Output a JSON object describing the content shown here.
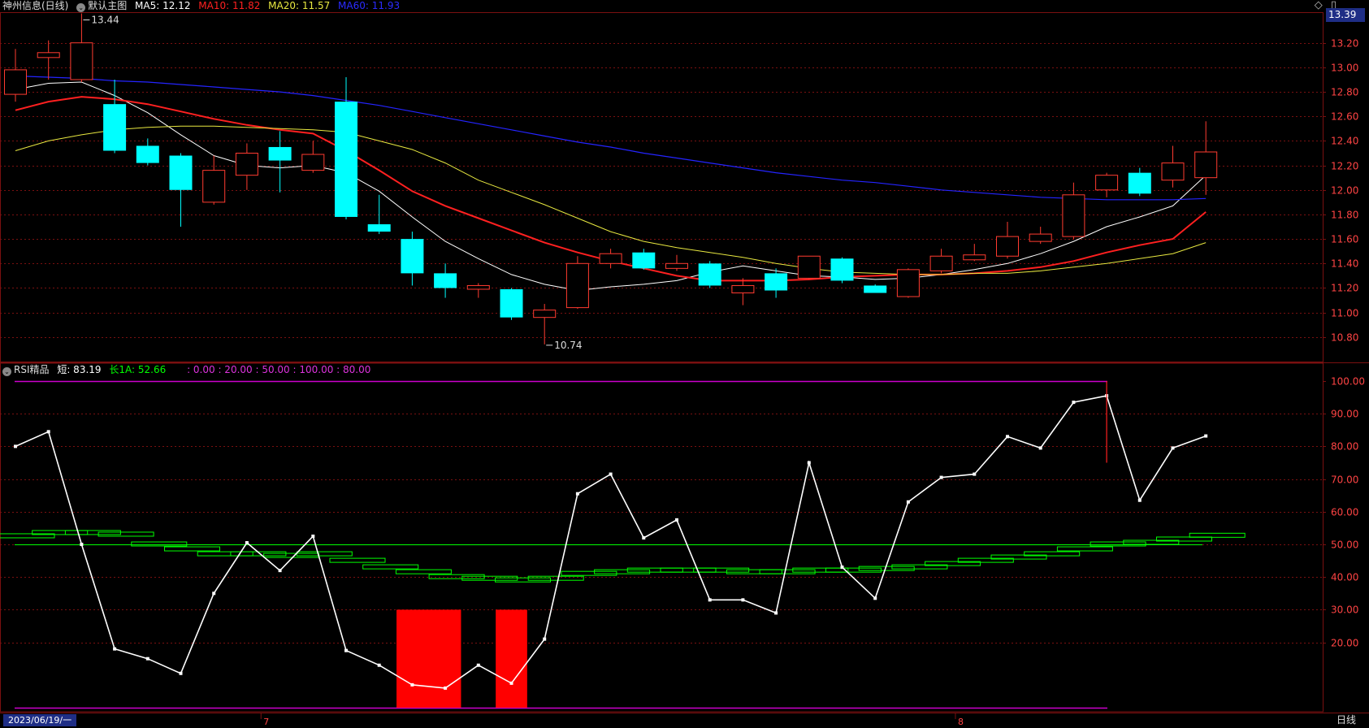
{
  "main_legend": {
    "title": "神州信息(日线)",
    "chart_name": "默认主图",
    "ma5_label": "MA5: 12.12",
    "ma10_label": "MA10: 11.82",
    "ma20_label": "MA20: 11.57",
    "ma60_label": "MA60: 11.93"
  },
  "rsi_legend": {
    "title": "RSI精品",
    "short_label": "短: 83.19",
    "long_label": "长1A: 52.66",
    "levels_label": ": 0.00 : 20.00 : 50.00 : 100.00 : 80.00"
  },
  "top_icons": {
    "diamond": "◇",
    "window": "▯"
  },
  "current_price": "13.39",
  "date_badge": "2023/06/19/一",
  "period_label": "日线",
  "colors": {
    "up": "#ff3b30",
    "down": "#00ffff",
    "ma5": "#ffffff",
    "ma10": "#ff2020",
    "ma20": "#e8e840",
    "ma60": "#2424ff",
    "rsi": "#ffffff",
    "long": "#00ff00",
    "band": "#cc00cc",
    "grid": "#7a1010",
    "axis_text": "#ff4444"
  },
  "chart_data": [
    {
      "type": "candlestick",
      "title": "神州信息(日线)",
      "ylim": [
        10.6,
        13.45
      ],
      "y_ticks": [
        "13.20",
        "13.00",
        "12.80",
        "12.60",
        "12.40",
        "12.20",
        "12.00",
        "11.80",
        "11.60",
        "11.40",
        "11.20",
        "11.00",
        "10.80"
      ],
      "x_labels": [
        {
          "index": 8,
          "label": "7"
        },
        {
          "index": 29,
          "label": "8"
        }
      ],
      "annotations": [
        {
          "index": 2,
          "value": 13.44,
          "label": "13.44",
          "position": "high"
        },
        {
          "index": 16,
          "value": 10.74,
          "label": "10.74",
          "position": "low"
        }
      ],
      "candles": [
        {
          "o": 12.78,
          "h": 13.15,
          "l": 12.72,
          "c": 12.98
        },
        {
          "o": 13.08,
          "h": 13.22,
          "l": 12.9,
          "c": 13.12
        },
        {
          "o": 12.9,
          "h": 13.44,
          "l": 12.88,
          "c": 13.2
        },
        {
          "o": 12.7,
          "h": 12.9,
          "l": 12.3,
          "c": 12.32
        },
        {
          "o": 12.36,
          "h": 12.42,
          "l": 12.2,
          "c": 12.22
        },
        {
          "o": 12.28,
          "h": 12.3,
          "l": 11.7,
          "c": 12.0
        },
        {
          "o": 11.9,
          "h": 12.28,
          "l": 11.88,
          "c": 12.16
        },
        {
          "o": 12.12,
          "h": 12.38,
          "l": 12.0,
          "c": 12.3
        },
        {
          "o": 12.35,
          "h": 12.48,
          "l": 11.98,
          "c": 12.24
        },
        {
          "o": 12.16,
          "h": 12.4,
          "l": 12.14,
          "c": 12.29
        },
        {
          "o": 12.72,
          "h": 12.92,
          "l": 11.76,
          "c": 11.78
        },
        {
          "o": 11.72,
          "h": 11.96,
          "l": 11.64,
          "c": 11.66
        },
        {
          "o": 11.6,
          "h": 11.66,
          "l": 11.22,
          "c": 11.32
        },
        {
          "o": 11.32,
          "h": 11.4,
          "l": 11.12,
          "c": 11.2
        },
        {
          "o": 11.19,
          "h": 11.24,
          "l": 11.12,
          "c": 11.22
        },
        {
          "o": 11.19,
          "h": 11.2,
          "l": 10.94,
          "c": 10.96
        },
        {
          "o": 10.96,
          "h": 11.07,
          "l": 10.74,
          "c": 11.02
        },
        {
          "o": 11.04,
          "h": 11.46,
          "l": 11.03,
          "c": 11.4
        },
        {
          "o": 11.4,
          "h": 11.52,
          "l": 11.36,
          "c": 11.48
        },
        {
          "o": 11.49,
          "h": 11.52,
          "l": 11.35,
          "c": 11.36
        },
        {
          "o": 11.36,
          "h": 11.47,
          "l": 11.34,
          "c": 11.4
        },
        {
          "o": 11.4,
          "h": 11.42,
          "l": 11.2,
          "c": 11.22
        },
        {
          "o": 11.16,
          "h": 11.28,
          "l": 11.06,
          "c": 11.22
        },
        {
          "o": 11.32,
          "h": 11.36,
          "l": 11.12,
          "c": 11.18
        },
        {
          "o": 11.28,
          "h": 11.46,
          "l": 11.27,
          "c": 11.46
        },
        {
          "o": 11.44,
          "h": 11.45,
          "l": 11.24,
          "c": 11.26
        },
        {
          "o": 11.22,
          "h": 11.23,
          "l": 11.16,
          "c": 11.16
        },
        {
          "o": 11.13,
          "h": 11.36,
          "l": 11.12,
          "c": 11.35
        },
        {
          "o": 11.34,
          "h": 11.52,
          "l": 11.32,
          "c": 11.46
        },
        {
          "o": 11.43,
          "h": 11.56,
          "l": 11.42,
          "c": 11.47
        },
        {
          "o": 11.46,
          "h": 11.74,
          "l": 11.44,
          "c": 11.62
        },
        {
          "o": 11.58,
          "h": 11.7,
          "l": 11.56,
          "c": 11.64
        },
        {
          "o": 11.62,
          "h": 12.06,
          "l": 11.6,
          "c": 11.96
        },
        {
          "o": 12.0,
          "h": 12.14,
          "l": 11.94,
          "c": 12.12
        },
        {
          "o": 12.14,
          "h": 12.18,
          "l": 11.95,
          "c": 11.97
        },
        {
          "o": 12.08,
          "h": 12.36,
          "l": 12.02,
          "c": 12.22
        },
        {
          "o": 12.1,
          "h": 12.56,
          "l": 11.96,
          "c": 12.31
        }
      ],
      "series": [
        {
          "name": "MA5",
          "values": [
            12.82,
            12.87,
            12.88,
            12.77,
            12.63,
            12.45,
            12.28,
            12.2,
            12.18,
            12.2,
            12.14,
            11.99,
            11.78,
            11.58,
            11.44,
            11.31,
            11.23,
            11.18,
            11.21,
            11.23,
            11.26,
            11.33,
            11.38,
            11.34,
            11.3,
            11.29,
            11.27,
            11.28,
            11.31,
            11.35,
            11.4,
            11.48,
            11.58,
            11.7,
            11.78,
            11.87,
            12.12
          ]
        },
        {
          "name": "MA10",
          "values": [
            12.65,
            12.72,
            12.76,
            12.74,
            12.7,
            12.64,
            12.58,
            12.53,
            12.49,
            12.46,
            12.32,
            12.16,
            11.99,
            11.87,
            11.77,
            11.67,
            11.57,
            11.49,
            11.42,
            11.36,
            11.3,
            11.26,
            11.26,
            11.26,
            11.27,
            11.29,
            11.3,
            11.31,
            11.31,
            11.32,
            11.34,
            11.37,
            11.42,
            11.49,
            11.55,
            11.6,
            11.82
          ]
        },
        {
          "name": "MA20",
          "values": [
            12.32,
            12.4,
            12.45,
            12.49,
            12.51,
            12.52,
            12.52,
            12.51,
            12.5,
            12.49,
            12.47,
            12.4,
            12.33,
            12.22,
            12.08,
            11.98,
            11.88,
            11.77,
            11.66,
            11.58,
            11.53,
            11.49,
            11.45,
            11.4,
            11.36,
            11.33,
            11.32,
            11.31,
            11.31,
            11.32,
            11.32,
            11.34,
            11.37,
            11.4,
            11.44,
            11.48,
            11.57
          ]
        },
        {
          "name": "MA60",
          "values": [
            12.93,
            12.92,
            12.91,
            12.89,
            12.88,
            12.86,
            12.84,
            12.82,
            12.8,
            12.77,
            12.73,
            12.69,
            12.64,
            12.59,
            12.54,
            12.49,
            12.44,
            12.39,
            12.35,
            12.3,
            12.26,
            12.22,
            12.18,
            12.14,
            12.11,
            12.08,
            12.06,
            12.03,
            12.0,
            11.98,
            11.96,
            11.94,
            11.93,
            11.92,
            11.92,
            11.92,
            11.93
          ]
        }
      ]
    },
    {
      "type": "line",
      "title": "RSI精品",
      "ylim": [
        0,
        100
      ],
      "y_ticks": [
        "100.00",
        "90.00",
        "80.00",
        "70.00",
        "60.00",
        "50.00",
        "40.00",
        "30.00",
        "20.00"
      ],
      "band_lines": [
        0,
        20,
        50,
        80,
        100
      ],
      "series": [
        {
          "name": "短",
          "values": [
            80.0,
            84.5,
            50.0,
            18.0,
            15.0,
            10.5,
            35.0,
            50.5,
            42.0,
            52.5,
            17.5,
            13.0,
            7.0,
            6.0,
            13.0,
            7.5,
            21.0,
            65.5,
            71.5,
            52.0,
            57.5,
            33.0,
            33.0,
            29.0,
            75.0,
            43.0,
            33.5,
            63.0,
            70.5,
            71.5,
            83.0,
            79.5,
            93.5,
            95.5,
            63.5,
            79.5,
            83.19
          ],
          "spike": {
            "index": 33,
            "from": 75.0,
            "to": 100.0
          }
        },
        {
          "name": "长1A",
          "values": [
            52.5,
            53.5,
            53.5,
            53.0,
            50.0,
            48.5,
            47.0,
            47.0,
            46.5,
            47.0,
            45.0,
            43.0,
            41.5,
            40.0,
            39.5,
            39.0,
            39.5,
            41.0,
            41.5,
            42.0,
            42.0,
            42.0,
            41.5,
            41.5,
            42.0,
            42.0,
            42.5,
            43.0,
            44.0,
            45.0,
            46.0,
            47.0,
            48.5,
            50.0,
            50.5,
            51.5,
            52.66
          ]
        }
      ],
      "signal_bars": [
        {
          "from": 12,
          "to": 13,
          "value": 30
        },
        {
          "from": 15,
          "to": 15,
          "value": 30
        }
      ]
    }
  ]
}
